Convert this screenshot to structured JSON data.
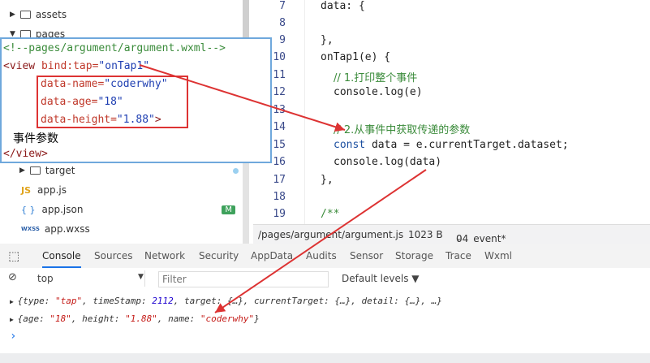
{
  "sidebar": {
    "items": [
      {
        "label": "assets",
        "kind": "folder",
        "expanded": false
      },
      {
        "label": "pages",
        "kind": "folder",
        "expanded": true
      },
      {
        "label": "target",
        "kind": "folder",
        "expanded": false
      },
      {
        "label": "app.js",
        "kind": "js"
      },
      {
        "label": "app.json",
        "kind": "json",
        "badge": "M"
      },
      {
        "label": "app.wxss",
        "kind": "wxss"
      }
    ],
    "file_icons": {
      "js": "JS",
      "json": "{ }",
      "wxss": "WXSS"
    }
  },
  "popup": {
    "comment": "<!--pages/argument/argument.wxml-->",
    "view_open": "<view",
    "bind_attr": "bind:tap=",
    "bind_val": "\"onTap1\"",
    "attrs": [
      {
        "name": "data-name=",
        "value": "\"coderwhy\""
      },
      {
        "name": "data-age=",
        "value": "\"18\""
      },
      {
        "name": "data-height=",
        "value": "\"1.88\"",
        "suffix": ">"
      }
    ],
    "text": "事件参数",
    "view_close": "</view>"
  },
  "editor": {
    "line_numbers": [
      "7",
      "8",
      "9",
      "10",
      "11",
      "12",
      "13",
      "14",
      "15",
      "16",
      "17",
      "18",
      "19"
    ],
    "lines": {
      "l7": "data: {",
      "l9": "},",
      "l10": "onTap1(e) {",
      "l11": "// 1.打印整个事件",
      "l12": "console.log(e)",
      "l14": "// 2.从事件中获取传递的参数",
      "l15_kw": "const",
      "l15_rest": " data = e.currentTarget.dataset;",
      "l16": "console.log(data)",
      "l17": "},",
      "l19": "/**"
    }
  },
  "statusbar": {
    "path": "/pages/argument/argument.js",
    "size": "1023 B",
    "branch": "04_event*"
  },
  "devtools": {
    "tabs": [
      "Console",
      "Sources",
      "Network",
      "Security",
      "AppData",
      "Audits",
      "Sensor",
      "Storage",
      "Trace",
      "Wxml"
    ],
    "active_tab": "Console",
    "context": "top",
    "filter_placeholder": "Filter",
    "levels": "Default levels ▼"
  },
  "console": {
    "line1": {
      "p1": "{type: ",
      "v1": "\"tap\"",
      "p2": ", timeStamp: ",
      "v2": "2112",
      "p3": ", target: {…}, currentTarget: {…}, detail: {…}, …}"
    },
    "line2": {
      "p1": "{age: ",
      "v1": "\"18\"",
      "p2": ", height: ",
      "v2": "\"1.88\"",
      "p3": ", name: ",
      "v3": "\"coderwhy\"",
      "p4": "}"
    },
    "prompt": "›"
  },
  "colors": {
    "accent": "#1a73e8",
    "highlight_red": "#d33333",
    "popup_border": "#6fa8dc"
  }
}
